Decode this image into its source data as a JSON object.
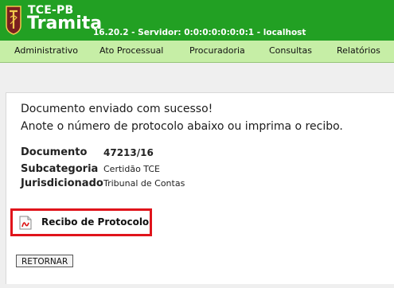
{
  "header": {
    "org": "TCE-PB",
    "app": "Tramita",
    "server_info": "16.20.2 - Servidor: 0:0:0:0:0:0:0:1 - localhost"
  },
  "nav": [
    "Administrativo",
    "Ato Processual",
    "Procuradoria",
    "Consultas",
    "Relatórios"
  ],
  "main": {
    "success_line1": "Documento enviado com sucesso!",
    "success_line2": "Anote o número de protocolo abaixo ou imprima o recibo.",
    "fields": [
      {
        "label": "Documento",
        "value": "47213/16"
      },
      {
        "label": "Subcategoria",
        "value": "Certidão TCE"
      },
      {
        "label": "Jurisdicionado",
        "value": "Tribunal de Contas"
      }
    ],
    "receipt_label": "Recibo de Protocolo",
    "return_button": "RETORNAR"
  },
  "colors": {
    "header_green": "#22a023",
    "nav_green": "#c6eea6",
    "highlight_red": "#e0141b"
  },
  "icons": [
    "tce-logo-icon",
    "pdf-icon"
  ]
}
